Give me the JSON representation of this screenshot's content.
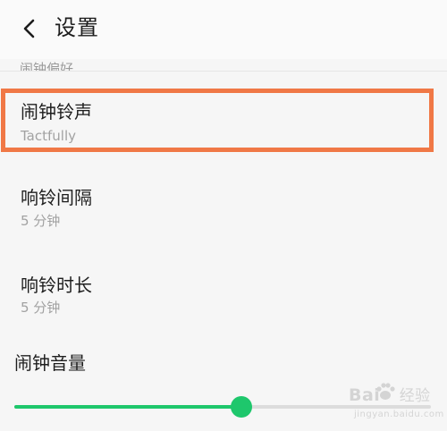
{
  "header": {
    "title": "设置",
    "back_icon": "chevron-left-icon"
  },
  "section": {
    "title": "闹钟偏好"
  },
  "items": [
    {
      "label": "闹钟铃声",
      "value": "Tactfully",
      "highlighted": true
    },
    {
      "label": "响铃间隔",
      "value": "5 分钟"
    },
    {
      "label": "响铃时长",
      "value": "5 分钟"
    }
  ],
  "volume": {
    "label": "闹钟音量",
    "level": 0.545
  },
  "watermark": {
    "brand": "Bai",
    "brand_suffix": "经验",
    "sub": "jingyan.baidu.com"
  },
  "colors": {
    "accent": "#1ec76c",
    "highlight": "#f07846",
    "track": "#dcdcdc",
    "background": "#f6f6f6"
  }
}
